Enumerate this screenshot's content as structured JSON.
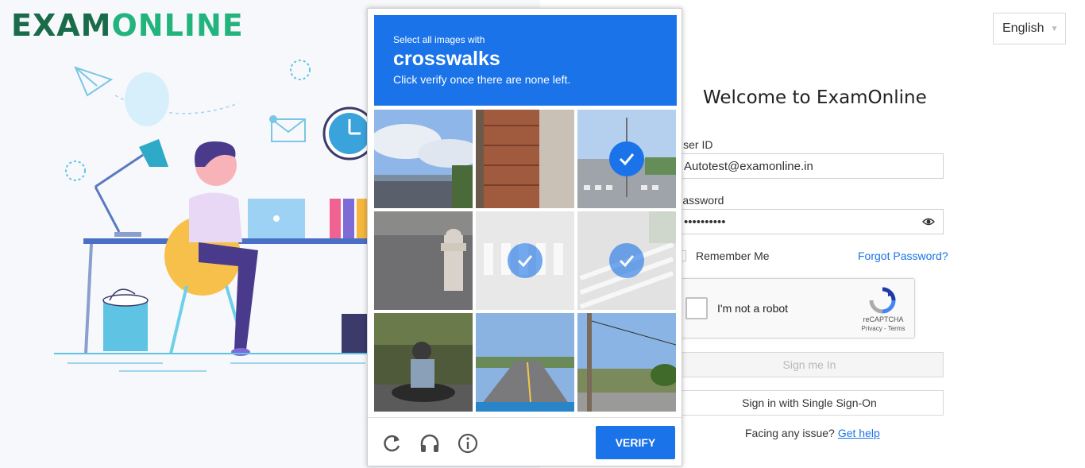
{
  "brand": {
    "logo_part1": "EXAM",
    "logo_part2": "ONLINE"
  },
  "header": {
    "language": "English"
  },
  "login": {
    "welcome": "Welcome to ExamOnline",
    "user_id_label": "User ID",
    "user_id_value": "Autotest@examonline.in",
    "password_label": "Password",
    "password_value": "••••••••••",
    "remember_label": "Remember Me",
    "forgot_label": "Forgot Password?",
    "signin_label": "Sign me In",
    "sso_label": "Sign in with Single Sign-On",
    "help_text": "Facing any issue?",
    "help_link": "Get help"
  },
  "recaptcha_widget": {
    "label": "I'm not a robot",
    "brand": "reCAPTCHA",
    "terms": "Privacy - Terms"
  },
  "captcha_challenge": {
    "instruction_small": "Select all images with",
    "target": "crosswalks",
    "instruction_sub": "Click verify once there are none left.",
    "verify_label": "VERIFY",
    "tiles": [
      {
        "scene": "sky-bridge",
        "selected": false
      },
      {
        "scene": "brick-wall",
        "selected": false
      },
      {
        "scene": "crosswalk-intersection",
        "selected": true
      },
      {
        "scene": "fire-hydrant",
        "selected": false
      },
      {
        "scene": "crosswalk-stripes",
        "selected": true
      },
      {
        "scene": "crosswalk-corner",
        "selected": true
      },
      {
        "scene": "scooter-rider",
        "selected": false
      },
      {
        "scene": "highway-road",
        "selected": false
      },
      {
        "scene": "utility-pole-street",
        "selected": false
      }
    ],
    "controls": [
      "reload-icon",
      "audio-icon",
      "info-icon"
    ]
  },
  "colors": {
    "accent": "#1a73e8",
    "brand_dark": "#1a6b4a",
    "brand_light": "#23b47e"
  }
}
